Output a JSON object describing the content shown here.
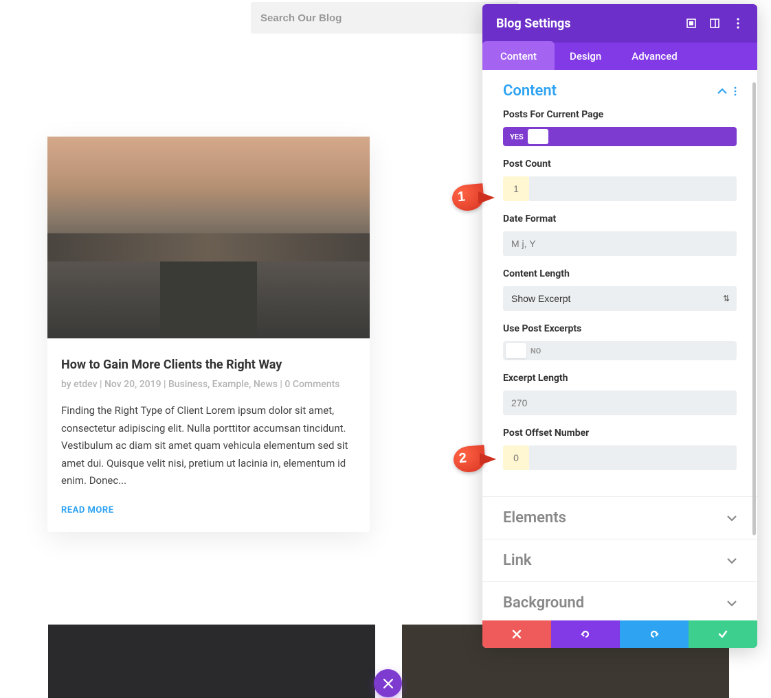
{
  "search": {
    "placeholder": "Search Our Blog"
  },
  "blog_card": {
    "title": "How to Gain More Clients the Right Way",
    "meta": "by etdev | Nov 20, 2019 | Business, Example, News | 0 Comments",
    "excerpt": "Finding the Right Type of Client Lorem ipsum dolor sit amet, consectetur adipiscing elit. Nulla porttitor accumsan tincidunt. Vestibulum ac diam sit amet quam vehicula elementum sed sit amet dui. Quisque velit nisi, pretium ut lacinia in, elementum id enim. Donec...",
    "read_more": "READ MORE"
  },
  "panel": {
    "title": "Blog Settings",
    "tabs": {
      "content": "Content",
      "design": "Design",
      "advanced": "Advanced"
    },
    "sections": {
      "content": {
        "title": "Content",
        "posts_current_page": {
          "label": "Posts For Current Page",
          "value": "YES"
        },
        "post_count": {
          "label": "Post Count",
          "value": "1"
        },
        "date_format": {
          "label": "Date Format",
          "placeholder": "M j, Y"
        },
        "content_length": {
          "label": "Content Length",
          "value": "Show Excerpt"
        },
        "use_post_excerpts": {
          "label": "Use Post Excerpts",
          "value": "NO"
        },
        "excerpt_length": {
          "label": "Excerpt Length",
          "value": "270"
        },
        "post_offset": {
          "label": "Post Offset Number",
          "placeholder": "0"
        }
      },
      "elements": {
        "title": "Elements"
      },
      "link": {
        "title": "Link"
      },
      "background": {
        "title": "Background"
      }
    }
  },
  "annotations": {
    "one": "1",
    "two": "2"
  }
}
